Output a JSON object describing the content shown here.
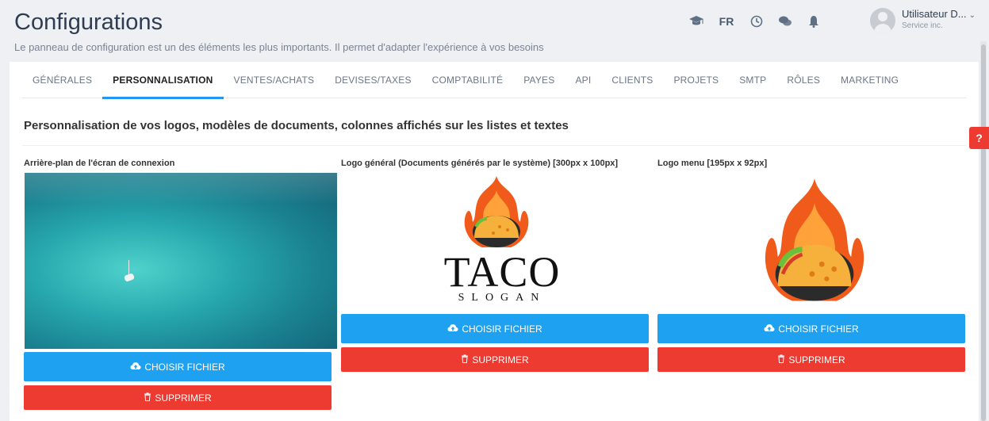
{
  "header": {
    "title": "Configurations",
    "subtitle": "Le panneau de configuration est un des éléments les plus importants. Il permet d'adapter l'expérience à vos besoins",
    "lang": "FR",
    "user": {
      "name": "Utilisateur D...",
      "company": "Service inc.",
      "caret": "⌄"
    },
    "icons": [
      "graduation-cap-icon",
      "clock-icon",
      "chat-icon",
      "bell-icon"
    ]
  },
  "tabs": [
    {
      "label": "GÉNÉRALES",
      "active": false
    },
    {
      "label": "PERSONNALISATION",
      "active": true
    },
    {
      "label": "VENTES/ACHATS",
      "active": false
    },
    {
      "label": "DEVISES/TAXES",
      "active": false
    },
    {
      "label": "COMPTABILITÉ",
      "active": false
    },
    {
      "label": "PAYES",
      "active": false
    },
    {
      "label": "API",
      "active": false
    },
    {
      "label": "CLIENTS",
      "active": false
    },
    {
      "label": "PROJETS",
      "active": false
    },
    {
      "label": "SMTP",
      "active": false
    },
    {
      "label": "RÔLES",
      "active": false
    },
    {
      "label": "MARKETING",
      "active": false
    }
  ],
  "section_title": "Personnalisation de vos logos, modèles de documents, colonnes affichés sur les listes et textes",
  "columns": [
    {
      "label": "Arrière-plan de l'écran de connexion",
      "choose_label": "CHOISIR FICHIER",
      "delete_label": "SUPPRIMER"
    },
    {
      "label": "Logo général (Documents générés par le système) [300px x 100px]",
      "choose_label": "CHOISIR FICHIER",
      "delete_label": "SUPPRIMER",
      "logo_text": "TACO",
      "logo_slogan": "SLOGAN"
    },
    {
      "label": "Logo menu [195px x 92px]",
      "choose_label": "CHOISIR FICHIER",
      "delete_label": "SUPPRIMER"
    }
  ],
  "help_label": "?",
  "colors": {
    "accent_blue": "#1ea1f1",
    "danger_red": "#ee3b32",
    "tab_underline": "#2196f3"
  }
}
